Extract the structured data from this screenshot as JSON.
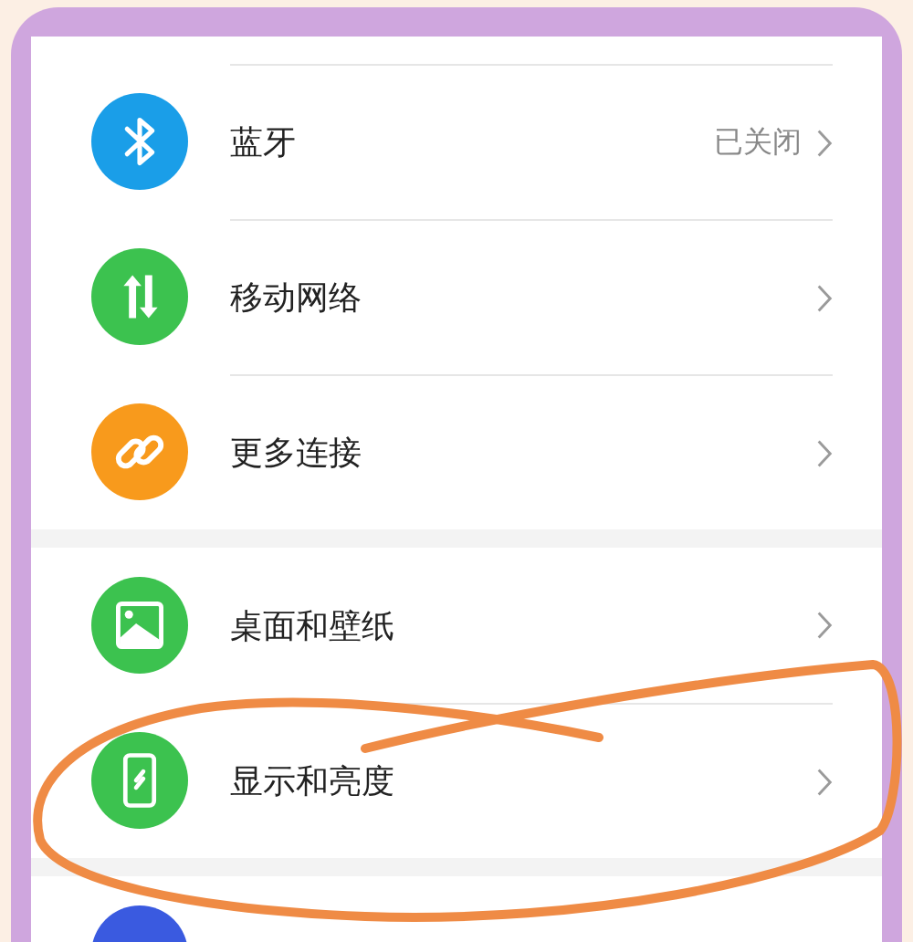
{
  "groups": [
    {
      "items": [
        {
          "label": "蓝牙",
          "value": "已关闭",
          "kind": "bluetooth",
          "color": "#1a9ee8"
        },
        {
          "label": "移动网络",
          "kind": "arrows",
          "color": "#3cc24f"
        },
        {
          "label": "更多连接",
          "kind": "link",
          "color": "#f89a1c"
        }
      ]
    },
    {
      "items": [
        {
          "label": "桌面和壁纸",
          "kind": "image",
          "color": "#3cc24f"
        },
        {
          "label": "显示和亮度",
          "kind": "phone",
          "color": "#3cc24f"
        }
      ]
    },
    {
      "items": [
        {
          "kind": "round",
          "color": "#3a5ae0"
        }
      ]
    }
  ]
}
